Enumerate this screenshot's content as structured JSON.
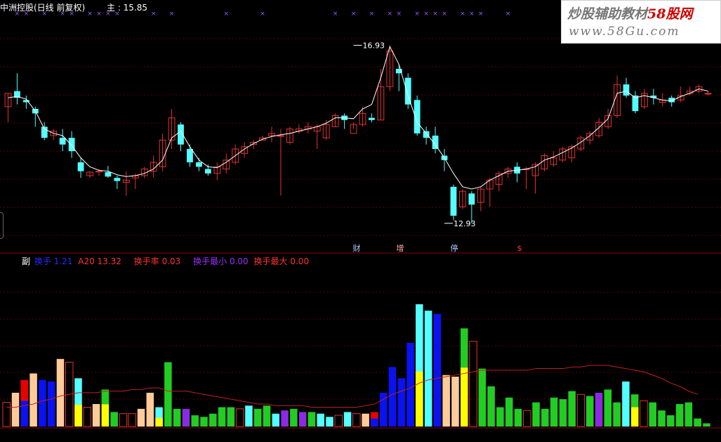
{
  "header": {
    "title": "中洲控股(日线 前复权)",
    "ma_label": "主 : 15.85"
  },
  "watermark": {
    "line1_a": "炒股辅助教材",
    "line1_b": "58股网",
    "line2": "www.58Gu.com"
  },
  "annotations": {
    "high_label": "16.93",
    "low_label": "12.93",
    "event_marks": [
      "财",
      "增",
      "停",
      "$"
    ]
  },
  "indicator_bar": {
    "prefix": "副",
    "items": [
      {
        "label": "换手",
        "value": "1.21",
        "color": "#2a2aff"
      },
      {
        "label": "A20",
        "value": "13.32",
        "color": "#ff3333"
      },
      {
        "label": "换手率",
        "value": "0.03",
        "color": "#ff3333"
      },
      {
        "label": "换手最小",
        "value": "0.00",
        "color": "#9b30ff"
      },
      {
        "label": "换手最大",
        "value": "0.00",
        "color": "#ff3333"
      }
    ]
  },
  "colors": {
    "up": "#e23232",
    "down": "#54ffff",
    "ma": "#ffffff",
    "marker": "#9b59ff",
    "grid": "#5a0000",
    "divider": "#8a0000",
    "avg_line": "#c02020",
    "vol": {
      "up_hollow": "#e23232",
      "down_cyan": "#54ffff",
      "peach": "#ffcc99",
      "blue": "#0a12f0",
      "green": "#22cc22",
      "purple": "#8a2be2",
      "yellow": "#ffff00",
      "red": "#e80000"
    }
  },
  "chart_data": [
    {
      "type": "candlestick",
      "title": "",
      "ylim": [
        12.5,
        17.6
      ],
      "max_point": {
        "index": 38,
        "value": 16.93
      },
      "min_point": {
        "index": 48,
        "value": 12.93
      },
      "candles": [
        [
          15.55,
          15.85,
          15.85,
          15.2
        ],
        [
          15.9,
          15.75,
          16.3,
          15.6
        ],
        [
          15.7,
          15.65,
          15.8,
          15.5
        ],
        [
          15.5,
          15.4,
          15.55,
          15.1
        ],
        [
          15.1,
          14.85,
          15.2,
          14.8
        ],
        [
          14.9,
          15.0,
          15.05,
          14.8
        ],
        [
          14.85,
          14.7,
          15.05,
          14.55
        ],
        [
          14.85,
          14.55,
          15.0,
          14.4
        ],
        [
          14.3,
          14.1,
          14.4,
          13.95
        ],
        [
          14.0,
          14.08,
          14.1,
          13.95
        ],
        [
          14.1,
          14.1,
          14.15,
          14.0
        ],
        [
          14.08,
          13.98,
          14.22,
          13.95
        ],
        [
          13.95,
          13.88,
          14.0,
          13.7
        ],
        [
          13.85,
          13.9,
          14.1,
          13.55
        ],
        [
          13.95,
          14.0,
          14.05,
          13.7
        ],
        [
          14.0,
          14.15,
          14.2,
          13.95
        ],
        [
          14.1,
          14.3,
          14.45,
          13.95
        ],
        [
          14.2,
          14.8,
          14.95,
          14.1
        ],
        [
          14.8,
          15.3,
          15.5,
          14.6
        ],
        [
          15.15,
          14.7,
          15.2,
          14.55
        ],
        [
          14.6,
          14.3,
          14.7,
          14.2
        ],
        [
          14.3,
          14.2,
          14.4,
          14.1
        ],
        [
          14.15,
          14.05,
          14.25,
          14.0
        ],
        [
          14.05,
          14.2,
          14.3,
          13.9
        ],
        [
          14.15,
          14.35,
          14.5,
          14.05
        ],
        [
          14.3,
          14.6,
          14.7,
          14.25
        ],
        [
          14.5,
          14.65,
          14.75,
          14.4
        ],
        [
          14.7,
          14.75,
          14.8,
          14.6
        ],
        [
          14.8,
          14.85,
          14.9,
          14.8
        ],
        [
          14.9,
          14.95,
          15.1,
          14.75
        ],
        [
          14.9,
          14.9,
          15.05,
          13.55
        ],
        [
          14.75,
          15.05,
          15.1,
          14.7
        ],
        [
          15.0,
          15.05,
          15.15,
          14.95
        ],
        [
          15.05,
          15.1,
          15.2,
          14.95
        ],
        [
          15.0,
          15.1,
          15.15,
          14.6
        ],
        [
          14.85,
          15.15,
          15.25,
          14.8
        ],
        [
          15.1,
          15.35,
          15.4,
          15.1
        ],
        [
          15.35,
          15.25,
          15.4,
          15.05
        ],
        [
          14.95,
          15.15,
          15.2,
          15.05
        ],
        [
          15.15,
          15.4,
          15.55,
          15.1
        ],
        [
          15.3,
          15.25,
          15.4,
          15.2
        ],
        [
          15.25,
          16.0,
          16.4,
          15.25
        ],
        [
          16.0,
          16.8,
          16.93,
          15.9
        ],
        [
          16.4,
          16.3,
          16.5,
          15.9
        ],
        [
          16.2,
          15.6,
          16.3,
          15.5
        ],
        [
          15.7,
          14.95,
          15.8,
          14.9
        ],
        [
          15.0,
          14.85,
          15.1,
          14.7
        ],
        [
          14.9,
          14.6,
          15.1,
          14.5
        ],
        [
          14.45,
          14.35,
          14.6,
          14.1
        ],
        [
          13.75,
          13.1,
          13.8,
          13.0
        ],
        [
          13.3,
          13.65,
          13.7,
          13.25
        ],
        [
          13.6,
          13.35,
          13.65,
          12.93
        ],
        [
          13.4,
          13.7,
          13.75,
          13.2
        ],
        [
          13.7,
          13.9,
          13.95,
          13.3
        ],
        [
          13.8,
          14.05,
          14.1,
          13.65
        ],
        [
          14.05,
          14.15,
          14.2,
          13.95
        ],
        [
          14.2,
          14.05,
          14.3,
          13.85
        ],
        [
          14.15,
          14.15,
          14.2,
          13.7
        ],
        [
          14.0,
          14.25,
          14.3,
          13.6
        ],
        [
          14.15,
          14.45,
          14.5,
          14.1
        ],
        [
          14.25,
          14.4,
          14.55,
          14.2
        ],
        [
          14.35,
          14.6,
          14.65,
          14.3
        ],
        [
          14.4,
          14.65,
          14.7,
          14.3
        ],
        [
          14.6,
          14.85,
          14.9,
          14.55
        ],
        [
          14.8,
          14.95,
          15.0,
          14.7
        ],
        [
          14.9,
          15.2,
          15.3,
          14.85
        ],
        [
          15.1,
          15.35,
          15.5,
          15.05
        ],
        [
          15.35,
          16.05,
          16.25,
          15.3
        ],
        [
          16.05,
          15.8,
          16.2,
          15.75
        ],
        [
          15.8,
          15.45,
          15.9,
          15.4
        ],
        [
          15.55,
          15.85,
          15.95,
          15.5
        ],
        [
          15.8,
          15.75,
          15.95,
          15.6
        ],
        [
          15.65,
          15.7,
          15.85,
          15.55
        ],
        [
          15.75,
          15.65,
          15.8,
          15.55
        ],
        [
          15.7,
          15.8,
          16.0,
          15.65
        ],
        [
          15.85,
          15.9,
          16.0,
          15.8
        ],
        [
          15.9,
          16.0,
          16.05,
          15.85
        ],
        [
          15.85,
          15.85,
          15.9,
          15.8
        ]
      ],
      "ma": [
        15.75,
        15.78,
        15.72,
        15.45,
        15.05,
        14.95,
        14.9,
        14.68,
        14.4,
        14.2,
        14.12,
        14.1,
        14.02,
        13.98,
        14.0,
        14.05,
        14.15,
        14.35,
        14.85,
        15.0,
        14.65,
        14.35,
        14.2,
        14.18,
        14.3,
        14.45,
        14.6,
        14.72,
        14.82,
        14.88,
        14.92,
        14.95,
        15.0,
        15.05,
        15.1,
        15.18,
        15.3,
        15.3,
        15.28,
        15.5,
        15.6,
        16.2,
        16.9,
        16.5,
        15.8,
        15.2,
        14.95,
        14.7,
        14.4,
        14.05,
        13.75,
        13.7,
        13.75,
        13.9,
        14.0,
        14.1,
        14.12,
        14.15,
        14.2,
        14.35,
        14.42,
        14.52,
        14.62,
        14.75,
        14.9,
        15.08,
        15.28,
        15.85,
        15.9,
        15.75,
        15.8,
        15.75,
        15.7,
        15.68,
        15.78,
        15.85,
        15.95,
        15.9
      ],
      "signal_markers_x": [
        1,
        2,
        4,
        6,
        7,
        9,
        10,
        11,
        12,
        16,
        18,
        24,
        28,
        36,
        38,
        40,
        42,
        43,
        45,
        46,
        47,
        48,
        50,
        51,
        52,
        55
      ]
    },
    {
      "type": "bar",
      "title": "",
      "series_note": "turnover",
      "ylim": [
        0,
        100
      ],
      "values": [
        15,
        21,
        29,
        33,
        29,
        28,
        42,
        40,
        30,
        12,
        14,
        23,
        9,
        8,
        8,
        11,
        21,
        12,
        40,
        11,
        11,
        7,
        6,
        8,
        12,
        12,
        11,
        13,
        11,
        13,
        8,
        10,
        11,
        9,
        9,
        8,
        6,
        7,
        9,
        8,
        8,
        9,
        21,
        37,
        30,
        52,
        76,
        72,
        70,
        32,
        31,
        61,
        53,
        36,
        25,
        12,
        18,
        11,
        10,
        15,
        11,
        18,
        17,
        22,
        20,
        19,
        21,
        23,
        15,
        28,
        20,
        16,
        15,
        10,
        7,
        14,
        15,
        5,
        2
      ],
      "colors": [
        "up_hollow",
        "peach",
        "blue_red",
        "peach",
        "blue",
        "blue",
        "peach",
        "up_hollow",
        "yellow_cyan",
        "up_hollow",
        "peach",
        "yellow_green",
        "green",
        "up_hollow",
        "up_hollow",
        "peach",
        "peach",
        "yellow_cyan",
        "green",
        "green",
        "purple",
        "green",
        "green",
        "green",
        "green",
        "green",
        "up_hollow",
        "cyan",
        "green",
        "green",
        "cyan",
        "purple",
        "green",
        "purple",
        "green",
        "cyan",
        "cyan",
        "up_hollow",
        "cyan",
        "up_hollow",
        "peach",
        "blue_red",
        "blue",
        "blue",
        "blue",
        "blue",
        "yellow_cyan",
        "cyan",
        "blue",
        "peach",
        "peach",
        "yellow_green",
        "up_hollow",
        "green",
        "green",
        "green",
        "green",
        "green",
        "up_hollow",
        "green",
        "green",
        "green",
        "green",
        "green",
        "up_hollow",
        "green",
        "purple",
        "green",
        "green",
        "cyan",
        "yellow_green",
        "up_hollow",
        "green",
        "green",
        "green",
        "green",
        "green",
        "green"
      ],
      "avg": [
        12,
        12,
        13,
        14,
        16,
        17,
        19,
        20,
        21,
        21,
        21,
        22,
        22,
        22,
        23,
        23,
        24,
        24,
        22,
        22,
        22,
        21,
        20,
        19,
        18,
        17,
        16,
        15,
        14,
        14,
        13,
        13,
        13,
        13,
        12,
        12,
        12,
        12,
        12,
        12,
        13,
        14,
        17,
        20,
        22,
        24,
        27,
        29,
        30,
        31,
        32,
        33,
        34,
        35,
        35,
        35,
        35,
        35,
        35,
        36,
        36,
        36,
        36,
        37,
        37,
        38,
        38,
        38,
        37,
        36,
        35,
        34,
        32,
        30,
        27,
        25,
        22,
        20
      ]
    }
  ]
}
